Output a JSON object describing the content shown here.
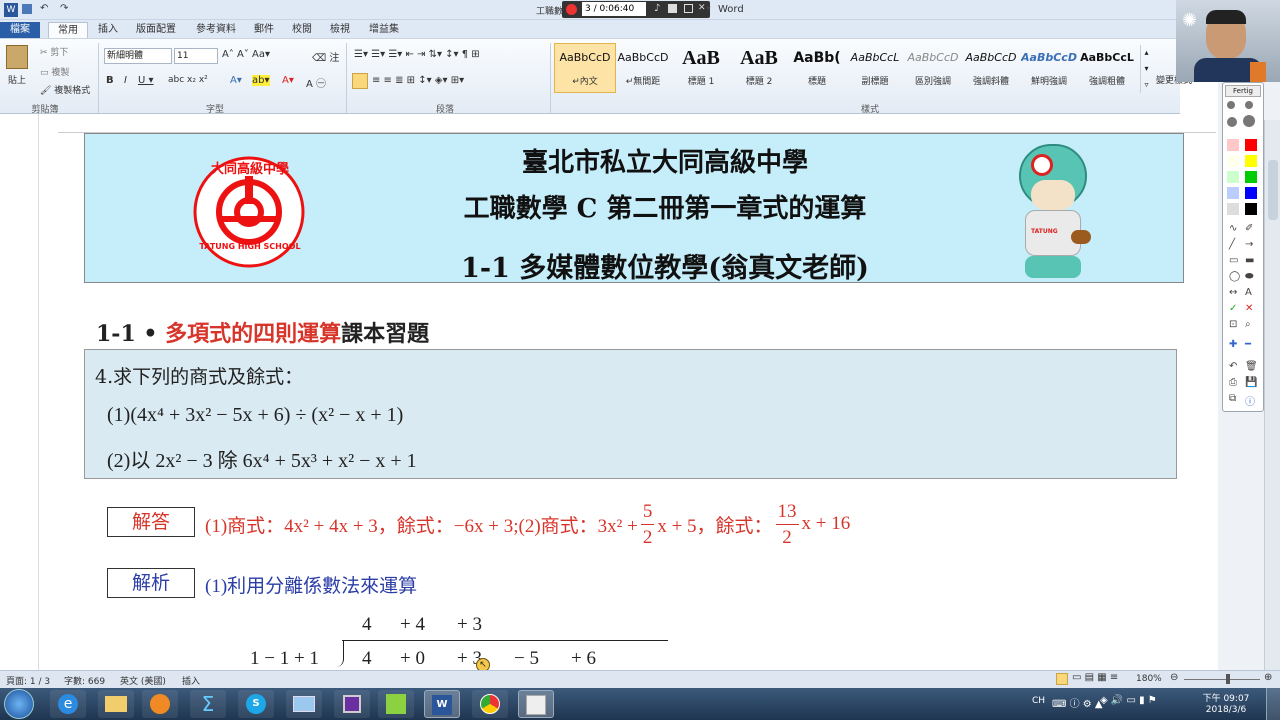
{
  "window": {
    "title_left": "工職數",
    "recorder_time": "3 / 0:06:40",
    "title_right": "Word"
  },
  "tabs": [
    "檔案",
    "常用",
    "插入",
    "版面配置",
    "參考資料",
    "郵件",
    "校閱",
    "檢視",
    "增益集"
  ],
  "clipboard": {
    "paste": "貼上",
    "cut": "剪下",
    "copy": "複製",
    "format_painter": "複製格式",
    "label": "剪貼簿"
  },
  "font": {
    "name": "新細明體",
    "size": "11",
    "label": "字型"
  },
  "paragraph": {
    "label": "段落"
  },
  "styles": {
    "label": "樣式",
    "items": [
      {
        "sample": "AaBbCcD",
        "name": "↵內文"
      },
      {
        "sample": "AaBbCcD",
        "name": "↵無間距"
      },
      {
        "sample": "AaB",
        "name": "標題 1"
      },
      {
        "sample": "AaB",
        "name": "標題 2"
      },
      {
        "sample": "AaBb(",
        "name": "標題"
      },
      {
        "sample": "AaBbCcL",
        "name": "副標題"
      },
      {
        "sample": "AaBbCcD",
        "name": "區別強調"
      },
      {
        "sample": "AaBbCcD",
        "name": "強調斜體"
      },
      {
        "sample": "AaBbCcD",
        "name": "鮮明強調"
      },
      {
        "sample": "AaBbCcL",
        "name": "強調粗體"
      }
    ],
    "change_styles": "變更樣式"
  },
  "palette": {
    "title": "Fertig"
  },
  "header": {
    "school": "臺北市私立大同高級中學",
    "course": "工職數學 C 第二冊第一章式的運算",
    "lesson": "1-1 多媒體數位教學(翁真文老師)",
    "logo_top": "大同高級中學",
    "logo_bottom": "TATUNG HIGH SCHOOL",
    "mascot_badge": "TATUNG"
  },
  "section": {
    "num": "1-1 •",
    "topic": "多項式的四則運算",
    "suffix": "課本習題"
  },
  "question": {
    "stem": "4.求下列的商式及餘式：",
    "part1": "(1)(4x⁴ + 3x² − 5x + 6) ÷ (x² − x + 1)",
    "part2": "(2)以 2x² − 3 除 6x⁴ + 5x³ + x² − x + 1"
  },
  "answer": {
    "label": "解答",
    "part_a": "(1)商式：4x² + 4x + 3，餘式：−6x + 3;(2)商式：3x² +",
    "frac1_num": "5",
    "frac1_den": "2",
    "part_b": "x + 5，餘式：",
    "frac2_num": "13",
    "frac2_den": "2",
    "part_c": "x + 16"
  },
  "analysis": {
    "label": "解析",
    "text": "(1)利用分離係數法來運算",
    "quotient_row": [
      "4",
      "+ 4",
      "+ 3"
    ],
    "divisor": "1 − 1 + 1",
    "dividend_row": [
      "4",
      "+ 0",
      "+ 3",
      "− 5",
      "+ 6"
    ]
  },
  "status": {
    "page": "頁面: 1 / 3",
    "words": "字數: 669",
    "lang": "英文 (美國)",
    "mode": "插入",
    "zoom": "180%"
  },
  "clock": {
    "time": "下午 09:07",
    "date": "2018/3/6",
    "ime": "CH"
  }
}
